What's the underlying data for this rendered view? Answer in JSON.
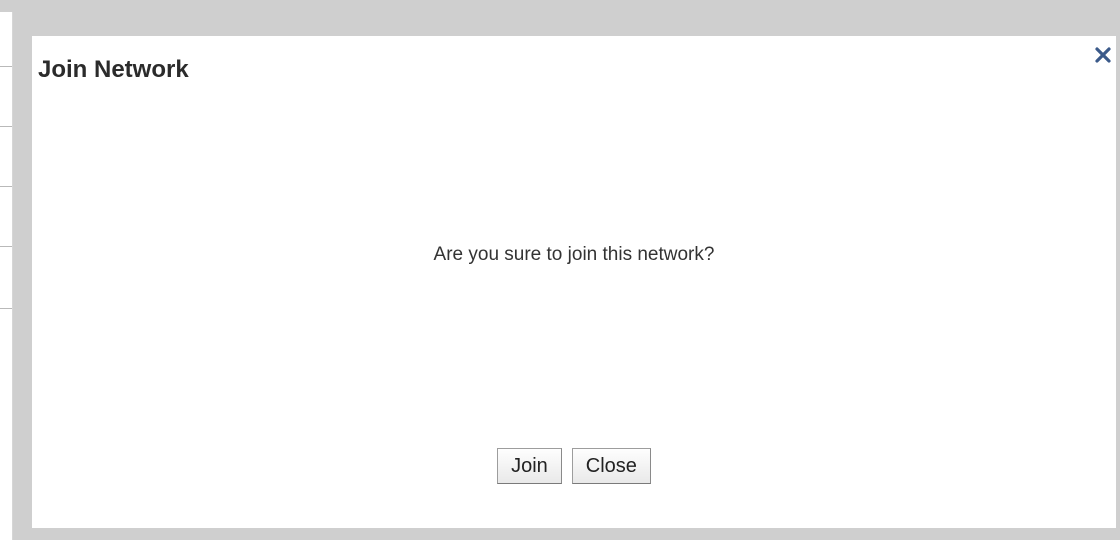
{
  "dialog": {
    "title": "Join Network",
    "close_icon": "close-icon",
    "message": "Are you sure to join this network?",
    "buttons": {
      "join_label": "Join",
      "close_label": "Close"
    }
  },
  "colors": {
    "overlay": "#cfcfcf",
    "dialog_background": "#ffffff",
    "close_icon": "#3b5a8a",
    "title_text": "#2b2b2b"
  }
}
